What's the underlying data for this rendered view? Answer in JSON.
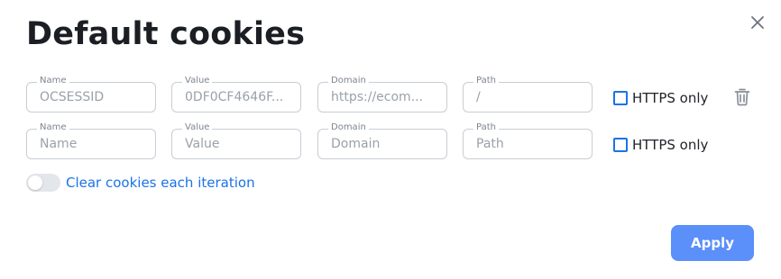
{
  "dialog": {
    "title": "Default cookies"
  },
  "cookies": {
    "rows": [
      {
        "name_label": "Name",
        "name_value": "OCSESSID",
        "value_label": "Value",
        "value_value": "0DF0CF4646F...",
        "domain_label": "Domain",
        "domain_value": "https://ecom...",
        "path_label": "Path",
        "path_value": "/",
        "https_label": "HTTPS only"
      },
      {
        "name_label": "Name",
        "name_placeholder": "Name",
        "value_label": "Value",
        "value_placeholder": "Value",
        "domain_label": "Domain",
        "domain_placeholder": "Domain",
        "path_label": "Path",
        "path_placeholder": "Path",
        "https_label": "HTTPS only"
      }
    ]
  },
  "options": {
    "clear_cookies_label": "Clear cookies each iteration",
    "clear_cookies_enabled": false
  },
  "footer": {
    "apply_label": "Apply"
  },
  "colors": {
    "accent": "#1a73e8",
    "apply_button": "#5b8ff9",
    "border": "#c9cdd3"
  },
  "icons": {
    "close": "close-icon",
    "delete": "trash-icon"
  }
}
